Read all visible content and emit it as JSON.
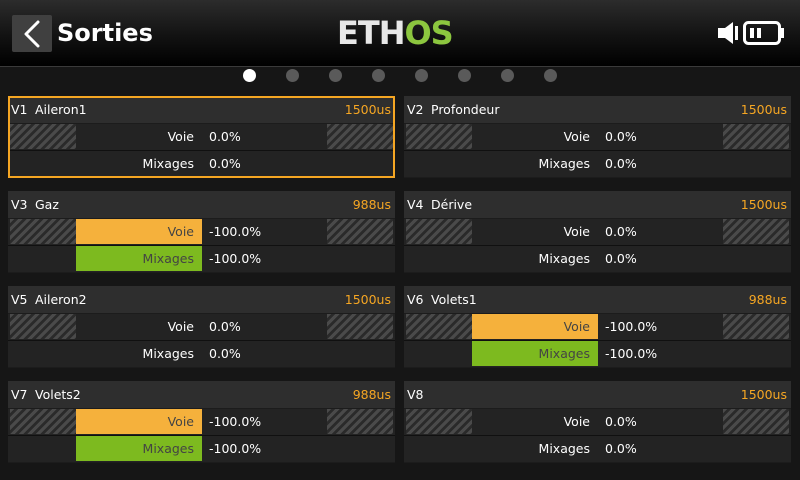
{
  "header": {
    "title": "Sorties",
    "logo_left": "ETH",
    "logo_right": "OS"
  },
  "pagination": {
    "count": 8,
    "active_index": 0
  },
  "channels": [
    {
      "id": "V1",
      "name": "Aileron1",
      "us": "1500us",
      "voie_label": "Voie",
      "voie_value": "0.0%",
      "mix_label": "Mixages",
      "mix_value": "0.0%",
      "bar": "none",
      "selected": true
    },
    {
      "id": "V2",
      "name": "Profondeur",
      "us": "1500us",
      "voie_label": "Voie",
      "voie_value": "0.0%",
      "mix_label": "Mixages",
      "mix_value": "0.0%",
      "bar": "none",
      "selected": false
    },
    {
      "id": "V3",
      "name": "Gaz",
      "us": "988us",
      "voie_label": "Voie",
      "voie_value": "-100.0%",
      "mix_label": "Mixages",
      "mix_value": "-100.0%",
      "bar": "min",
      "selected": false
    },
    {
      "id": "V4",
      "name": "Dérive",
      "us": "1500us",
      "voie_label": "Voie",
      "voie_value": "0.0%",
      "mix_label": "Mixages",
      "mix_value": "0.0%",
      "bar": "none",
      "selected": false
    },
    {
      "id": "V5",
      "name": "Aileron2",
      "us": "1500us",
      "voie_label": "Voie",
      "voie_value": "0.0%",
      "mix_label": "Mixages",
      "mix_value": "0.0%",
      "bar": "none",
      "selected": false
    },
    {
      "id": "V6",
      "name": "Volets1",
      "us": "988us",
      "voie_label": "Voie",
      "voie_value": "-100.0%",
      "mix_label": "Mixages",
      "mix_value": "-100.0%",
      "bar": "min",
      "selected": false
    },
    {
      "id": "V7",
      "name": "Volets2",
      "us": "988us",
      "voie_label": "Voie",
      "voie_value": "-100.0%",
      "mix_label": "Mixages",
      "mix_value": "-100.0%",
      "bar": "min",
      "selected": false
    },
    {
      "id": "V8",
      "name": "",
      "us": "1500us",
      "voie_label": "Voie",
      "voie_value": "0.0%",
      "mix_label": "Mixages",
      "mix_value": "0.0%",
      "bar": "none",
      "selected": false
    }
  ],
  "colors": {
    "accent": "#f5a623",
    "voie_bar": "#f5b13c",
    "mix_bar": "#7dba1f",
    "logo_green": "#8cc63f"
  },
  "icons": {
    "back": "chevron-left-icon",
    "speaker": "speaker-icon",
    "battery": "battery-icon"
  }
}
